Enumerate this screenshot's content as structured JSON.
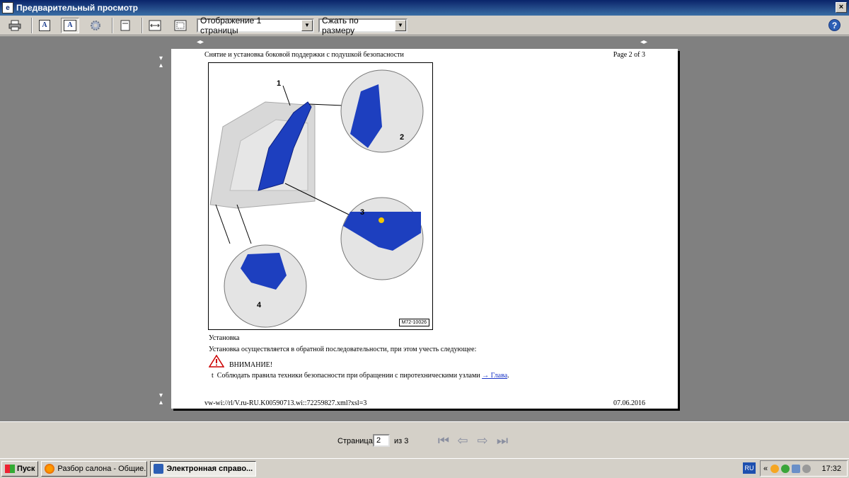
{
  "window": {
    "title": "Предварительный просмотр",
    "close_label": "×",
    "app_icon_label": "e"
  },
  "toolbar": {
    "page_display": "Отображение 1 страницы",
    "zoom": "Сжать по размеру",
    "help_label": "?"
  },
  "page": {
    "header_left": "Снятие и установка боковой поддержки с подушкой безопасности",
    "header_right": "Page 2 of 3",
    "figure": {
      "code": "M72-10026",
      "callouts": [
        "1",
        "2",
        "3",
        "4"
      ]
    },
    "section_title": "Установка",
    "body_text": "Установка осуществляется в обратной последовательности, при этом учесть следующее:",
    "warning_title": "ВНИМАНИЕ!",
    "bullet": "t",
    "warning_text": "Соблюдать правила техники безопасности при обращении с пиротехническими узлами",
    "warning_link": "→ Глава",
    "warning_end": ".",
    "footer_left": "vw-wi://rl/V.ru-RU.K00590713.wi::72259827.xml?xsl=3",
    "footer_right": "07.06.2016"
  },
  "navigation": {
    "page_label": "Страница",
    "current_page": "2",
    "of_label": "из 3"
  },
  "taskbar": {
    "start_label": "Пуск",
    "tasks": [
      {
        "label": "Разбор салона - Общие..."
      },
      {
        "label": "Электронная справо..."
      }
    ],
    "language": "RU",
    "chevron": "«",
    "clock": "17:32"
  },
  "colors": {
    "accent": "#0a246a",
    "preview_bg": "#808080",
    "part_blue": "#1d3fbf"
  }
}
